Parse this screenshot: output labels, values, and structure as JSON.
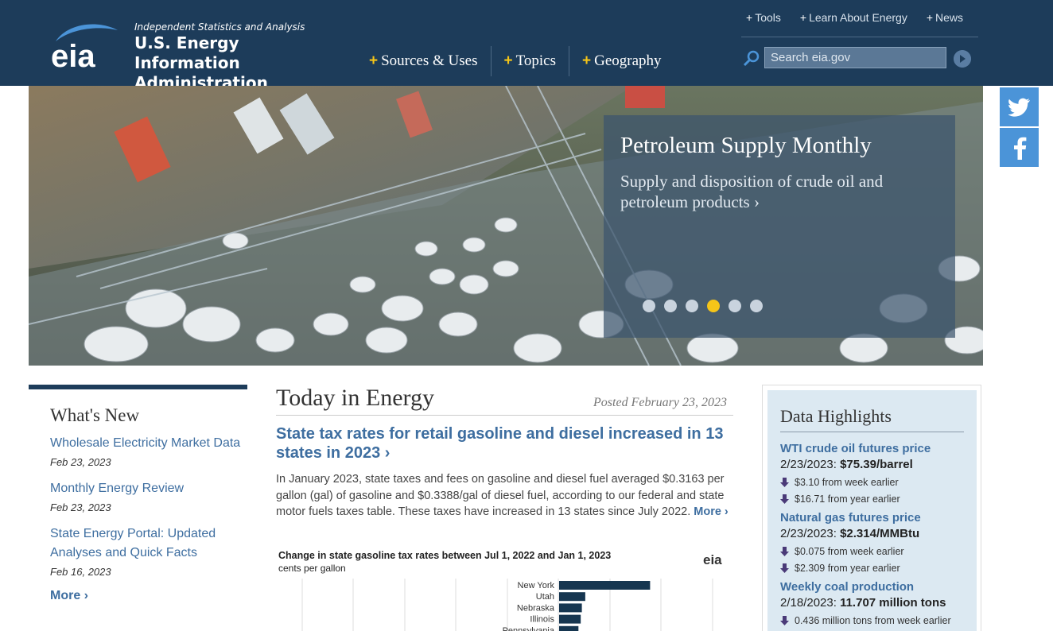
{
  "header": {
    "tagline": "Independent Statistics and Analysis",
    "name_line1": "U.S. Energy Information",
    "name_line2": "Administration",
    "logo_text": "eia",
    "main_nav": [
      "Sources & Uses",
      "Topics",
      "Geography"
    ],
    "top_nav": [
      "Tools",
      "Learn About Energy",
      "News"
    ],
    "search_placeholder": "Search eia.gov"
  },
  "hero": {
    "title": "Petroleum Supply Monthly",
    "subtitle": "Supply and disposition of crude oil and petroleum products  ›",
    "dots": 6,
    "active_dot": 4
  },
  "social": [
    "twitter-icon",
    "facebook-icon"
  ],
  "whats_new": {
    "title": "What's New",
    "items": [
      {
        "label": "Wholesale Electricity Market Data",
        "date": "Feb 23, 2023"
      },
      {
        "label": "Monthly Energy Review",
        "date": "Feb 23, 2023"
      },
      {
        "label": "State Energy Portal: Updated Analyses and Quick Facts",
        "date": "Feb 16, 2023"
      }
    ],
    "more": "More ›"
  },
  "today_in_energy": {
    "title": "Today in Energy",
    "posted": "Posted February 23, 2023",
    "headline": "State tax rates for retail gasoline and diesel increased in 13 states in 2023 ›",
    "body": "In January 2023, state taxes and fees on gasoline and diesel fuel averaged $0.3163 per gallon (gal) of gasoline and $0.3388/gal of diesel fuel, according to our federal and state motor fuels taxes table. These taxes have increased in 13 states since July 2022.",
    "more": "More ›"
  },
  "chart_data": {
    "type": "bar",
    "title": "Change in state gasoline tax rates between Jul 1, 2022 and Jan 1, 2023",
    "units": "cents per gallon",
    "logo": "eia",
    "categories": [
      "New York",
      "Utah",
      "Nebraska",
      "Illinois",
      "Pennsylvania"
    ],
    "values": [
      8.0,
      2.3,
      2.0,
      1.9,
      1.7
    ]
  },
  "data_highlights": {
    "title": "Data Highlights",
    "items": [
      {
        "label": "WTI crude oil futures price",
        "date": "2/23/2023:",
        "value": "$75.39/barrel",
        "changes": [
          "$3.10 from week earlier",
          "$16.71 from year earlier"
        ]
      },
      {
        "label": "Natural gas futures price",
        "date": "2/23/2023:",
        "value": "$2.314/MMBtu",
        "changes": [
          "$0.075 from week earlier",
          "$2.309 from year earlier"
        ]
      },
      {
        "label": "Weekly coal production",
        "date": "2/18/2023:",
        "value": "11.707 million tons",
        "changes": [
          "0.436 million tons from week earlier"
        ]
      }
    ],
    "colors": {
      "down_arrow": "#4a3a78"
    }
  }
}
